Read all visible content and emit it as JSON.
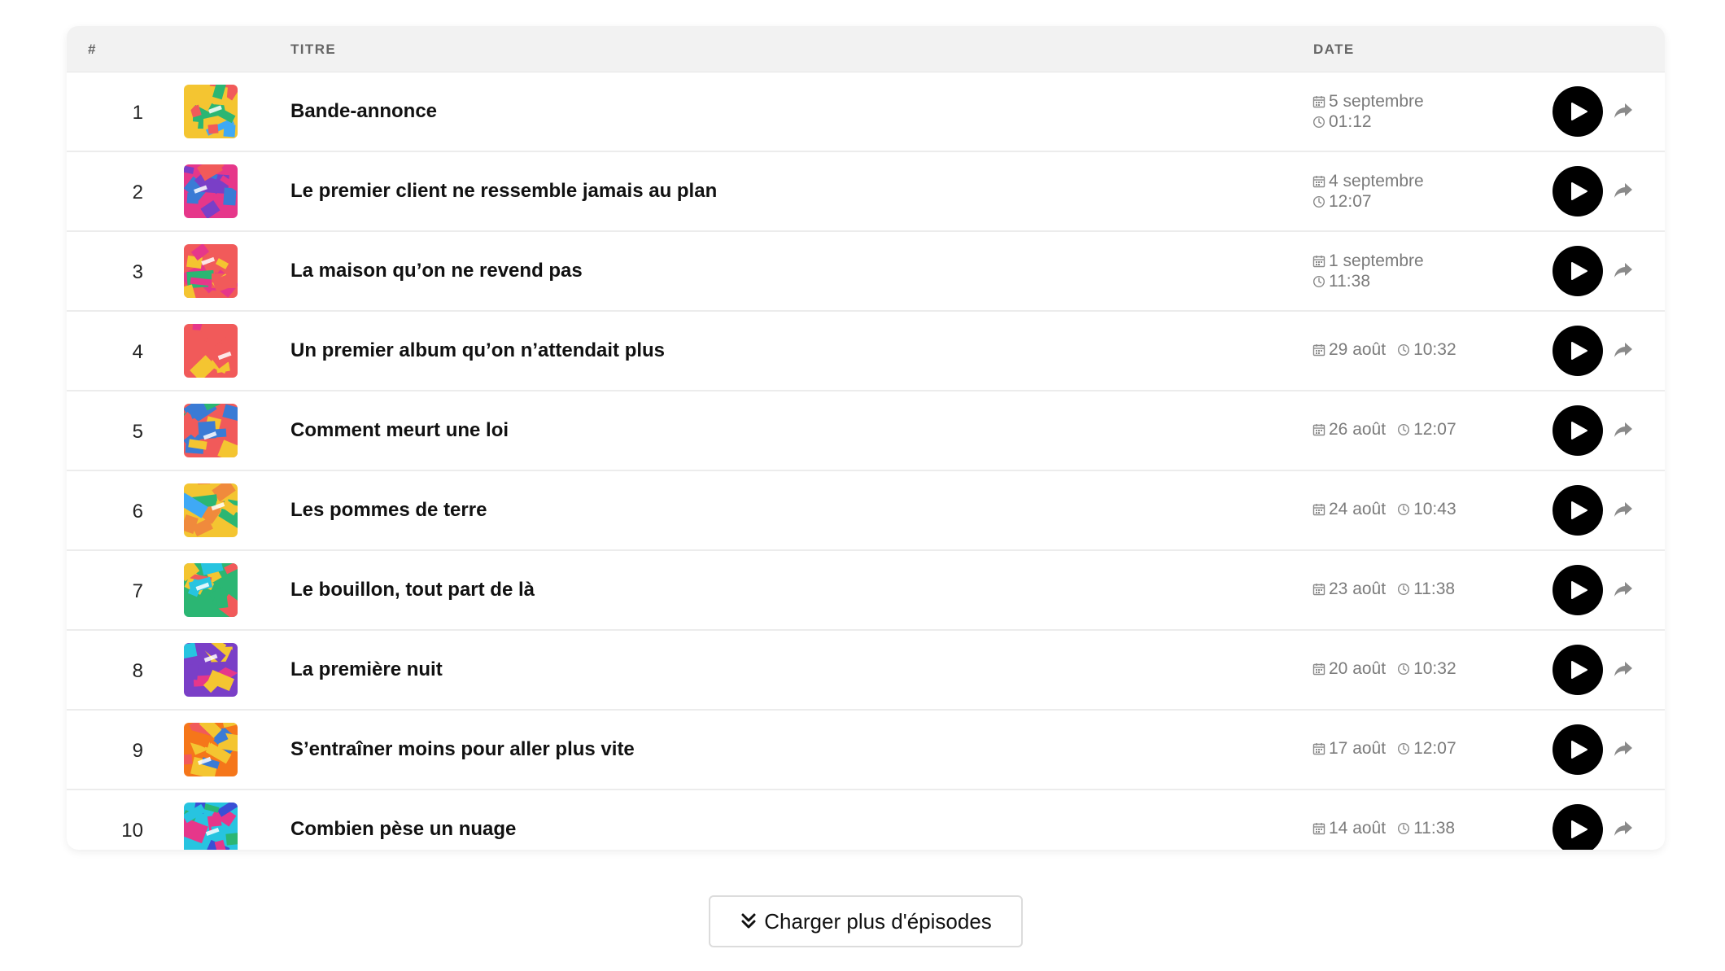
{
  "header": {
    "num_label": "#",
    "title_label": "TITRE",
    "date_label": "DATE"
  },
  "icons": {
    "calendar": "calendar-icon",
    "clock": "clock-icon",
    "play": "play-icon",
    "share": "share-icon",
    "load_more": "double-chevron-down-icon"
  },
  "episodes": [
    {
      "num": "1",
      "title": "Bande-annonce",
      "date": "5 septembre",
      "time": "01:12",
      "layout": "two-line",
      "palette": [
        "#f4c531",
        "#2bb673",
        "#f15a5a",
        "#3fa9f5"
      ]
    },
    {
      "num": "2",
      "title": "Le premier client ne ressemble jamais au plan",
      "date": "4 septembre",
      "time": "12:07",
      "layout": "two-line",
      "palette": [
        "#e6378a",
        "#3a7bd5",
        "#7a3fc7",
        "#f15a5a"
      ]
    },
    {
      "num": "3",
      "title": "La maison qu’on ne revend pas",
      "date": "1 septembre",
      "time": "11:38",
      "layout": "two-line",
      "palette": [
        "#f15a5a",
        "#2bb673",
        "#f4c531",
        "#e6378a"
      ]
    },
    {
      "num": "4",
      "title": "Un premier album qu’on n’attendait plus",
      "date": "29 août",
      "time": "10:32",
      "layout": "one-line",
      "palette": [
        "#f15a5a",
        "#27c4e0",
        "#e6378a",
        "#f4c531"
      ]
    },
    {
      "num": "5",
      "title": "Comment meurt une loi",
      "date": "26 août",
      "time": "12:07",
      "layout": "one-line",
      "palette": [
        "#f15a5a",
        "#3a7bd5",
        "#2bb673",
        "#f4c531"
      ]
    },
    {
      "num": "6",
      "title": "Les pommes de terre",
      "date": "24 août",
      "time": "10:43",
      "layout": "one-line",
      "palette": [
        "#f4c531",
        "#2bb673",
        "#f08a3c",
        "#3fa9f5"
      ]
    },
    {
      "num": "7",
      "title": "Le bouillon, tout part de là",
      "date": "23 août",
      "time": "11:38",
      "layout": "one-line",
      "palette": [
        "#2bb673",
        "#f15a5a",
        "#f4c531",
        "#27c4e0"
      ]
    },
    {
      "num": "8",
      "title": "La première nuit",
      "date": "20 août",
      "time": "10:32",
      "layout": "one-line",
      "palette": [
        "#7a3fc7",
        "#f4c531",
        "#27c4e0",
        "#e6378a"
      ]
    },
    {
      "num": "9",
      "title": "S’entraîner moins pour aller plus vite",
      "date": "17 août",
      "time": "12:07",
      "layout": "one-line",
      "palette": [
        "#f5761a",
        "#3a7bd5",
        "#f4c531",
        "#f15a5a"
      ]
    },
    {
      "num": "10",
      "title": "Combien pèse un nuage",
      "date": "14 août",
      "time": "11:38",
      "layout": "one-line",
      "palette": [
        "#27c4e0",
        "#3a4fd5",
        "#2bb673",
        "#e6378a"
      ]
    }
  ],
  "load_more": {
    "label": "Charger plus d'épisodes"
  }
}
